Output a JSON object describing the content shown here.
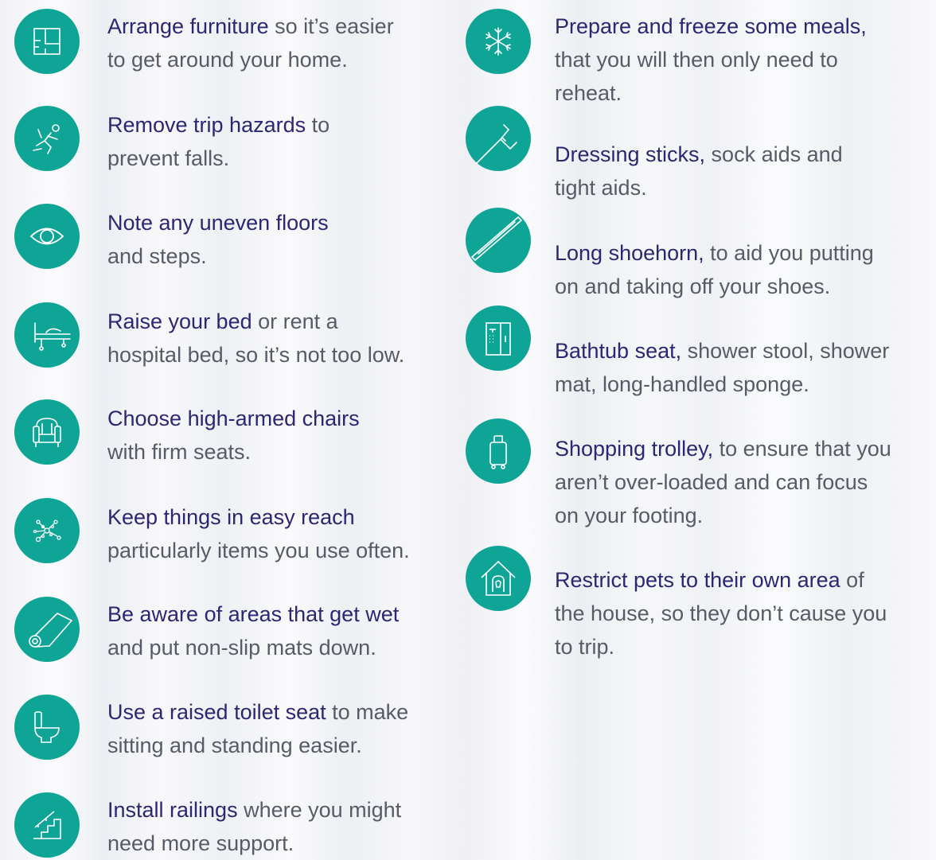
{
  "left_column": {
    "items": [
      {
        "icon": "floor-plan-icon",
        "highlight": "Arrange furniture",
        "line1_rest": " so it’s easier",
        "line2": "to get around your home."
      },
      {
        "icon": "falling-person-icon",
        "highlight": "Remove trip hazards",
        "line1_rest": " to",
        "line2": "prevent falls."
      },
      {
        "icon": "eye-icon",
        "highlight": "Note any uneven floors",
        "line1_rest": "",
        "line2": "and steps."
      },
      {
        "icon": "bed-icon",
        "highlight": "Raise your bed",
        "line1_rest": " or rent a",
        "line2": "hospital bed, so it’s not too low."
      },
      {
        "icon": "armchair-icon",
        "highlight": "Choose high-armed chairs",
        "line1_rest": "",
        "line2": "with firm seats."
      },
      {
        "icon": "network-icon",
        "highlight": "Keep things in easy reach",
        "line1_rest": "",
        "line2": "particularly items you use often."
      },
      {
        "icon": "mat-roll-icon",
        "highlight": "Be aware of areas that get wet",
        "line1_rest": "",
        "line2": "and put non-slip mats down."
      },
      {
        "icon": "toilet-icon",
        "highlight": "Use a raised toilet seat",
        "line1_rest": " to make",
        "line2": "sitting and standing easier."
      },
      {
        "icon": "stairs-railing-icon",
        "highlight": "Install railings",
        "line1_rest": " where you might",
        "line2": "need more support."
      }
    ]
  },
  "right_column": {
    "items": [
      {
        "icon": "snowflake-icon",
        "highlight": "Prepare and freeze some meals,",
        "line1_rest": "",
        "line2": "that you will then only need to",
        "line3": "reheat."
      },
      {
        "icon": "dressing-stick-icon",
        "highlight": "Dressing sticks,",
        "line1_rest": " sock aids and",
        "line2": "tight aids."
      },
      {
        "icon": "shoehorn-icon",
        "highlight": "Long shoehorn,",
        "line1_rest": " to aid you putting",
        "line2": "on and taking off your shoes."
      },
      {
        "icon": "shower-icon",
        "highlight": "Bathtub seat,",
        "line1_rest": " shower stool, shower",
        "line2": "mat, long-handled sponge."
      },
      {
        "icon": "trolley-icon",
        "highlight": "Shopping trolley,",
        "line1_rest": " to ensure that you",
        "line2": "aren’t over-loaded and can focus",
        "line3": "on your footing."
      },
      {
        "icon": "pet-house-icon",
        "highlight": "Restrict pets to their own area",
        "line1_rest": " of",
        "line2": "the house, so they don’t cause you",
        "line3": "to trip."
      }
    ]
  },
  "colors": {
    "icon_bg": "#0fa596",
    "highlight_text": "#2e2573",
    "body_text": "#565b66"
  }
}
